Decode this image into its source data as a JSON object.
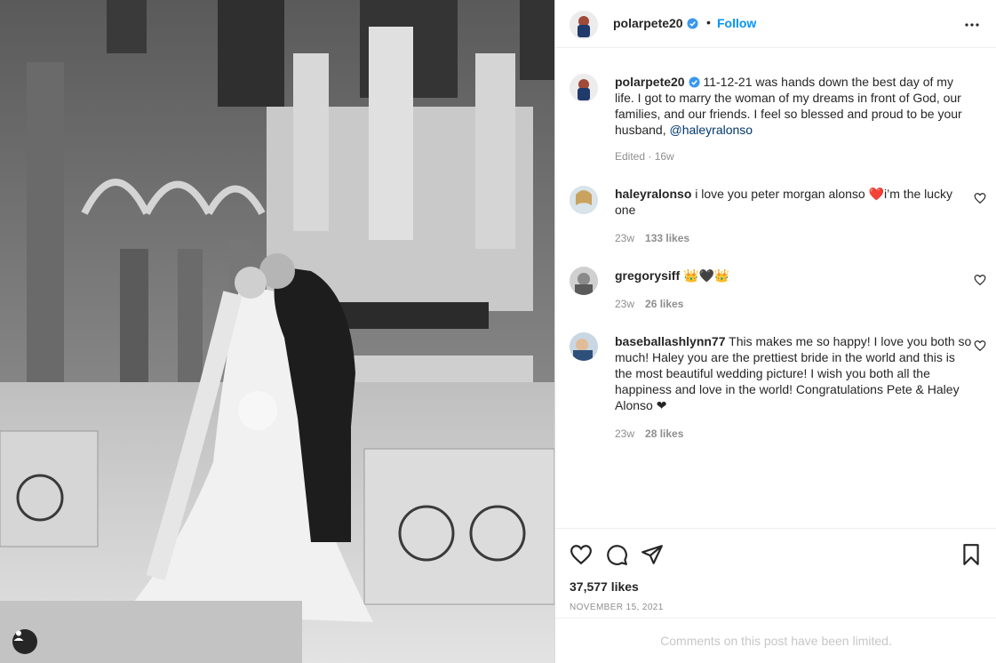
{
  "post": {
    "photo_alt": "",
    "user_tag_icon": "person-icon"
  },
  "header": {
    "username": "polarpete20",
    "separator": "•",
    "follow_label": "Follow",
    "more_icon": "ellipsis-icon"
  },
  "caption": {
    "username": "polarpete20",
    "text": "11-12-21 was hands down the best day of my life. I got to marry the woman of my dreams in front of God, our families, and our friends. I feel so blessed and proud to be your husband,",
    "mention": "@haleyralonso",
    "edited": "Edited",
    "time": "16w"
  },
  "comments": [
    {
      "username": "haleyralonso",
      "text": "i love you peter morgan alonso ❤️i’m the lucky one",
      "time": "23w",
      "likes": "133 likes"
    },
    {
      "username": "gregorysiff",
      "text": "👑🖤👑",
      "time": "23w",
      "likes": "26 likes"
    },
    {
      "username": "baseballashlynn77",
      "text": "This makes me so happy! I love you both so much! Haley you are the prettiest bride in the world and this is the most beautiful wedding picture! I wish you both all the happiness and love in the world! Congratulations Pete & Haley Alonso ❤",
      "time": "23w",
      "likes": "28 likes"
    }
  ],
  "actions": {
    "like_icon": "heart-icon",
    "comment_icon": "comment-icon",
    "share_icon": "send-icon",
    "save_icon": "bookmark-icon",
    "likes_count": "37,577 likes",
    "date": "NOVEMBER 15, 2021"
  },
  "footer": {
    "limited_text": "Comments on this post have been limited."
  },
  "colors": {
    "link": "#0095f6",
    "mention": "#00376b",
    "verified": "#3897f0",
    "text": "#262626",
    "muted": "#8e8e8e"
  }
}
